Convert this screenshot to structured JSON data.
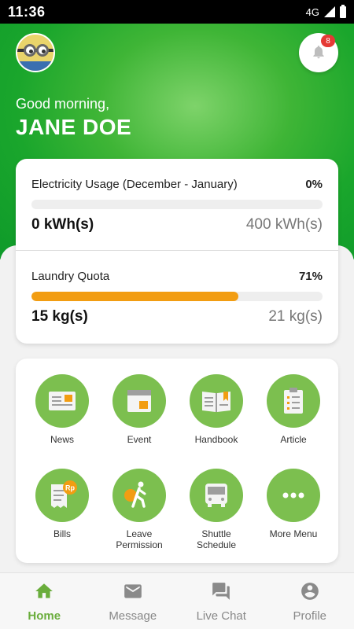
{
  "status_bar": {
    "time": "11:36",
    "network": "4G"
  },
  "header": {
    "greeting": "Good morning,",
    "user_name": "JANE DOE",
    "notification_count": "8"
  },
  "usage": [
    {
      "title": "Electricity Usage (December - January)",
      "percent_label": "0%",
      "progress": 0,
      "used": "0 kWh(s)",
      "limit": "400 kWh(s)"
    },
    {
      "title": "Laundry Quota",
      "percent_label": "71%",
      "progress": 0.71,
      "used": "15 kg(s)",
      "limit": "21 kg(s)"
    }
  ],
  "menu": [
    {
      "label": "News",
      "icon": "news-icon"
    },
    {
      "label": "Event",
      "icon": "calendar-icon"
    },
    {
      "label": "Handbook",
      "icon": "book-icon"
    },
    {
      "label": "Article",
      "icon": "clipboard-icon"
    },
    {
      "label": "Bills",
      "icon": "bill-icon",
      "icon_text": "Rp"
    },
    {
      "label": "Leave\nPermission",
      "icon": "walking-person-icon"
    },
    {
      "label": "Shuttle\nSchedule",
      "icon": "bus-icon"
    },
    {
      "label": "More Menu",
      "icon": "more-icon"
    }
  ],
  "bottom_nav": [
    {
      "label": "Home",
      "icon": "home-icon",
      "active": true
    },
    {
      "label": "Message",
      "icon": "mail-icon",
      "active": false
    },
    {
      "label": "Live Chat",
      "icon": "chat-icon",
      "active": false
    },
    {
      "label": "Profile",
      "icon": "profile-icon",
      "active": false
    }
  ],
  "colors": {
    "brand_green": "#1aa62c",
    "menu_green": "#7cbf4f",
    "progress_orange": "#f29d12",
    "nav_active": "#6aad3c",
    "badge_red": "#e53935"
  }
}
